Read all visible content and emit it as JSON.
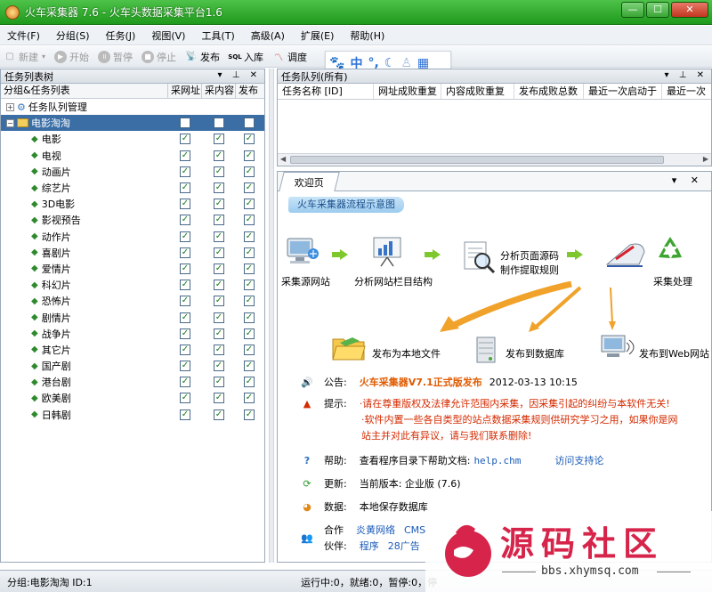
{
  "window": {
    "title": "火车采集器 7.6 - 火车头数据采集平台1.6"
  },
  "menu": [
    "文件(F)",
    "分组(S)",
    "任务(J)",
    "视图(V)",
    "工具(T)",
    "高级(A)",
    "扩展(E)",
    "帮助(H)"
  ],
  "toolbar": {
    "new": "新建",
    "start": "开始",
    "pause": "暂停",
    "stop": "停止",
    "publish": "发布",
    "import": "入库",
    "schedule": "调度"
  },
  "ime": {
    "mode": "中"
  },
  "left_panel": {
    "title": "任务列表树",
    "cols": [
      "分组&任务列表",
      "采网址",
      "采内容",
      "发布"
    ],
    "rows": [
      {
        "label": "任务队列管理"
      },
      {
        "label": "电影淘淘"
      },
      {
        "label": "电影"
      },
      {
        "label": "电视"
      },
      {
        "label": "动画片"
      },
      {
        "label": "综艺片"
      },
      {
        "label": "3D电影"
      },
      {
        "label": "影视预告"
      },
      {
        "label": "动作片"
      },
      {
        "label": "喜剧片"
      },
      {
        "label": "爱情片"
      },
      {
        "label": "科幻片"
      },
      {
        "label": "恐怖片"
      },
      {
        "label": "剧情片"
      },
      {
        "label": "战争片"
      },
      {
        "label": "其它片"
      },
      {
        "label": "国产剧"
      },
      {
        "label": "港台剧"
      },
      {
        "label": "欧美剧"
      },
      {
        "label": "日韩剧"
      }
    ]
  },
  "task_queue": {
    "title": "任务队列(所有)",
    "cols": [
      "任务名称 [ID]",
      "网址成败重复",
      "内容成败重复",
      "发布成败总数",
      "最近一次启动于",
      "最近一次"
    ]
  },
  "tabs": {
    "welcome": "欢迎页"
  },
  "flow": {
    "title": "火车采集器流程示意图",
    "steps": {
      "source": "采集源网站",
      "analyze": "分析网站栏目结构",
      "extract1": "分析页面源码",
      "extract2": "制作提取规则",
      "process": "采集处理",
      "local": "发布为本地文件",
      "db": "发布到数据库",
      "web": "发布到Web网站"
    }
  },
  "notice": {
    "announce_label": "公告:",
    "announce_title": "火车采集器V7.1正式版发布",
    "announce_date": "2012-03-13 10:15",
    "tip_label": "提示:",
    "tip_line1": "·请在尊重版权及法律允许范围内采集，因采集引起的纠纷与本软件无关!",
    "tip_line2": "·软件内置一些各自类型的站点数据采集规则供研究学习之用，如果你是网",
    "tip_line3": "站主并对此有异议，请与我们联系删除!",
    "help_label": "帮助:",
    "help_text": "查看程序目录下帮助文档:",
    "help_file": "help.chm",
    "help_link": "访问支持论",
    "update_label": "更新:",
    "update_text": "当前版本: 企业版 (7.6)",
    "data_label": "数据:",
    "data_text": "本地保存数据库",
    "partner_label1": "合作",
    "partner_label2": "伙伴:",
    "partner1": "炎黄网络",
    "partner2": "CMS",
    "partner3": "程序",
    "partner4": "28广告"
  },
  "status": {
    "left": "分组:电影淘淘  ID:1",
    "right": "运行中:0，就绪:0，暂停:0，停"
  },
  "watermark": {
    "brand": "源码社区",
    "url": "bbs.xhymsq.com"
  }
}
